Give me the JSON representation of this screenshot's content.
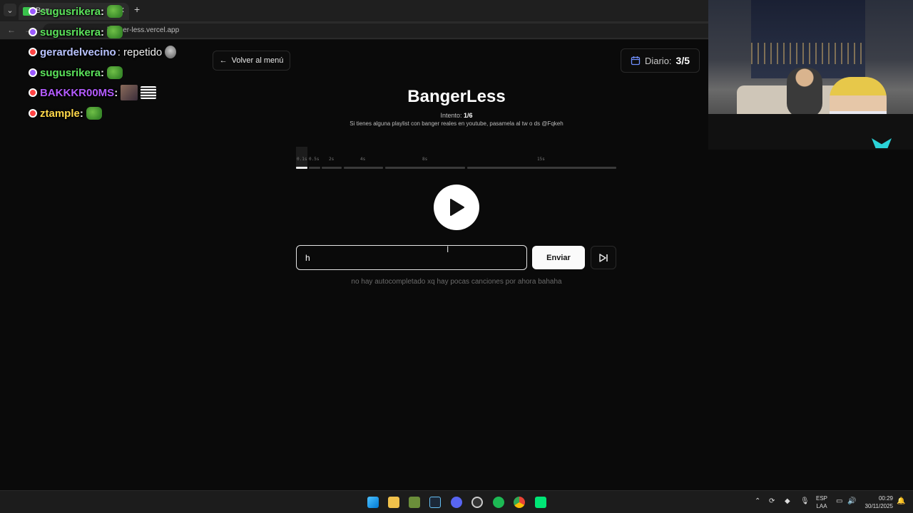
{
  "browser": {
    "tab_title": "Ban",
    "url": "banger-less.vercel.app"
  },
  "chat": [
    {
      "user": "sugusrikera",
      "color": "#5be35b",
      "badge": "#9b59ff",
      "text": ":",
      "emote": "pepe"
    },
    {
      "user": "sugusrikera",
      "color": "#5be35b",
      "badge": "#9b59ff",
      "text": ":",
      "emote": "pepe"
    },
    {
      "user": "gerardelvecino",
      "color": "#b9c3ff",
      "badge": "#ff4444",
      "text": ": repetido",
      "emote": "grey"
    },
    {
      "user": "sugusrikera",
      "color": "#5be35b",
      "badge": "#9b59ff",
      "text": ":",
      "emote": "pepe"
    },
    {
      "user": "BAKKKR00MS",
      "color": "#b45bff",
      "badge": "#ff4444",
      "text": ":",
      "emote": "face"
    },
    {
      "user": "ztample",
      "color": "#ffd84a",
      "badge": "#ff4444",
      "text": ":",
      "emote": "pepe"
    }
  ],
  "app": {
    "back_label": "Volver al menú",
    "daily_label": "Diario:",
    "daily_value": "3/5",
    "title": "BangerLess",
    "attempt_prefix": "Intento: ",
    "attempt_value": "1/6",
    "hint": "Si tienes alguna playlist con banger reales en youtube, pasamela al tw o ds @Fqkeh",
    "segments": [
      "0.1s",
      "0.5s",
      "2s",
      "4s",
      "8s",
      "15s"
    ],
    "active_segment": 0,
    "guess_value": "h",
    "send_label": "Enviar",
    "note": "no hay autocompletado xq hay pocas canciones por ahora bahaha"
  },
  "taskbar": {
    "lang_top": "ESP",
    "lang_bottom": "LAA",
    "time": "00:29",
    "date": "30/11/2025"
  },
  "colors": {
    "background": "#0a0a0a",
    "accent": "#ffffff",
    "calendar": "#6f8fff"
  }
}
